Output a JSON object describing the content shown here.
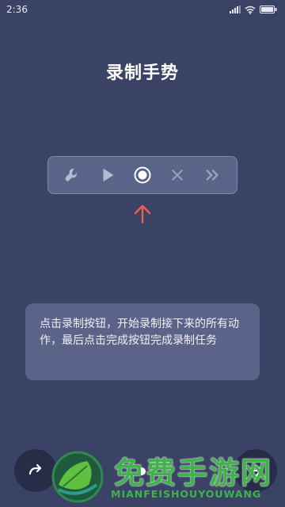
{
  "status_bar": {
    "time": "2:36",
    "icons": [
      "signal-icon",
      "wifi-icon",
      "battery-icon"
    ]
  },
  "page": {
    "title": "录制手势"
  },
  "toolbar": {
    "items": [
      {
        "name": "wrench-icon",
        "state": "inactive"
      },
      {
        "name": "play-icon",
        "state": "inactive"
      },
      {
        "name": "record-icon",
        "state": "active"
      },
      {
        "name": "close-icon",
        "state": "inactive"
      },
      {
        "name": "fast-forward-icon",
        "state": "inactive"
      }
    ]
  },
  "pointer": {
    "icon": "arrow-up-icon",
    "color": "#e8624f"
  },
  "tip": {
    "text": "点击录制按钮，开始录制接下来的所有动作，最后点击完成按钮完成录制任务"
  },
  "bottom": {
    "left_button_icon": "redo-icon",
    "right_button_icon": "next-icon",
    "page_indicator_active": 1
  },
  "watermark": {
    "title": "免费手游网",
    "subtitle": "MIANFEISHOUYOUWANG",
    "color": "#3fb24a"
  },
  "colors": {
    "background": "#3a4366",
    "toolbar": "#5a6489",
    "card": "#5b6389",
    "accent_arrow": "#e8624f"
  }
}
